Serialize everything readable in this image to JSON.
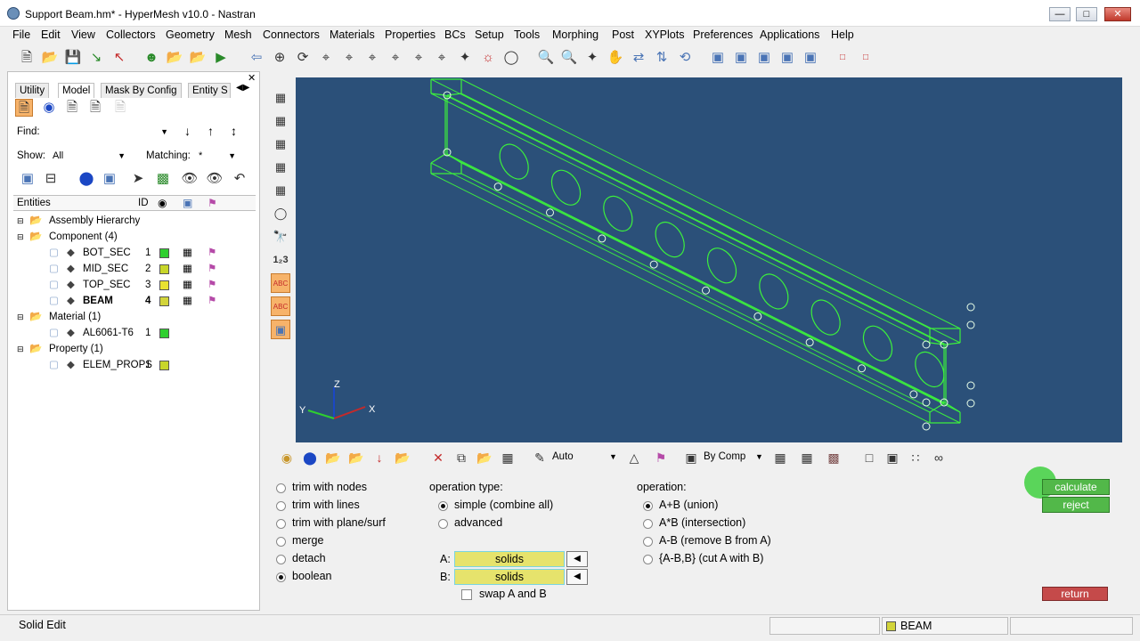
{
  "window": {
    "title": "Support Beam.hm* - HyperMesh v10.0 - Nastran"
  },
  "menu": [
    "File",
    "Edit",
    "View",
    "Collectors",
    "Geometry",
    "Mesh",
    "Connectors",
    "Materials",
    "Properties",
    "BCs",
    "Setup",
    "Tools",
    "Morphing",
    "Post",
    "XYPlots",
    "Preferences",
    "Applications",
    "Help"
  ],
  "left": {
    "tabs": [
      "Utility",
      "Model",
      "Mask By Config",
      "Entity S"
    ],
    "find_label": "Find:",
    "find_value": "",
    "show_label": "Show:",
    "show_value": "All",
    "matching_label": "Matching:",
    "matching_value": "*",
    "tree_header": {
      "entities": "Entities",
      "id": "ID"
    },
    "tree": [
      {
        "label": "Assembly Hierarchy",
        "id": "",
        "level": 0
      },
      {
        "label": "Component (4)",
        "id": "",
        "level": 0
      },
      {
        "label": "BOT_SEC",
        "id": "1",
        "level": 1,
        "color": "#2fcf2f"
      },
      {
        "label": "MID_SEC",
        "id": "2",
        "level": 1,
        "color": "#c8d62a"
      },
      {
        "label": "TOP_SEC",
        "id": "3",
        "level": 1,
        "color": "#e8e22f"
      },
      {
        "label": "BEAM",
        "id": "4",
        "level": 1,
        "color": "#d2d43a",
        "bold": true
      },
      {
        "label": "Material (1)",
        "id": "",
        "level": 0
      },
      {
        "label": "AL6061-T6",
        "id": "1",
        "level": 1,
        "color": "#2fcf2f"
      },
      {
        "label": "Property (1)",
        "id": "",
        "level": 0
      },
      {
        "label": "ELEM_PROPS",
        "id": "1",
        "level": 1,
        "color": "#c8d62a"
      }
    ]
  },
  "viewport": {
    "axis_x": "X",
    "axis_y": "Y",
    "axis_z": "Z",
    "bg": "#2b5079",
    "mesh_color": "#3cf03c"
  },
  "bottom_toolbar": {
    "auto": "Auto",
    "by_comp": "By Comp"
  },
  "panel": {
    "modes": [
      {
        "label": "trim with nodes",
        "on": false
      },
      {
        "label": "trim with lines",
        "on": false
      },
      {
        "label": "trim with plane/surf",
        "on": false
      },
      {
        "label": "merge",
        "on": false
      },
      {
        "label": "detach",
        "on": false
      },
      {
        "label": "boolean",
        "on": true
      }
    ],
    "op_type_label": "operation type:",
    "op_types": [
      {
        "label": "simple (combine all)",
        "on": true
      },
      {
        "label": "advanced",
        "on": false
      }
    ],
    "a_label": "A:",
    "a_value": "solids",
    "b_label": "B:",
    "b_value": "solids",
    "swap_label": "swap A and B",
    "operation_label": "operation:",
    "operations": [
      {
        "label": "A+B (union)",
        "on": true
      },
      {
        "label": "A*B (intersection)",
        "on": false
      },
      {
        "label": "A-B (remove B from A)",
        "on": false
      },
      {
        "label": "{A-B,B} (cut A with B)",
        "on": false
      }
    ],
    "calculate": "calculate",
    "reject": "reject",
    "return": "return"
  },
  "status": {
    "text": "Solid Edit",
    "component": "BEAM"
  }
}
